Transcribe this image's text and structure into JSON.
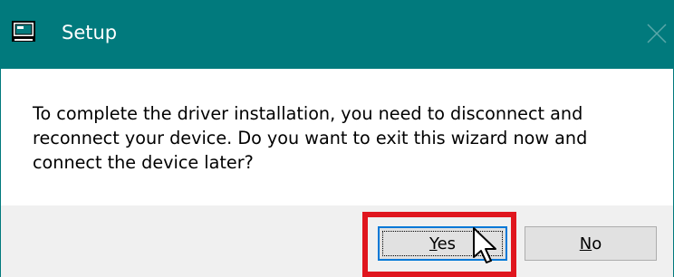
{
  "window": {
    "title": "Setup",
    "icon": "setup-app-icon",
    "close_icon": "close-icon",
    "titlebar_color": "#017a7d"
  },
  "message": "To complete the driver installation, you need to disconnect and reconnect your device. Do you want to exit this wizard now and connect the device later?",
  "buttons": {
    "yes": {
      "mnemonic": "Y",
      "rest": "es",
      "focused": true
    },
    "no": {
      "mnemonic": "N",
      "rest": "o",
      "focused": false
    }
  },
  "annotation": {
    "highlight_color": "#e0161e",
    "target": "yes-button"
  },
  "cursor": "arrow-cursor-icon"
}
